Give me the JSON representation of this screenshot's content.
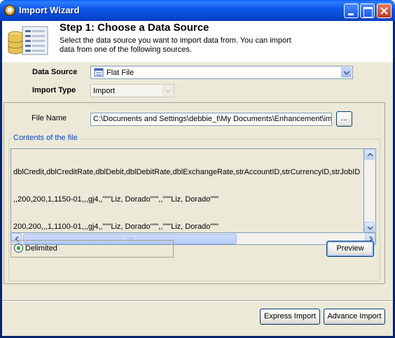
{
  "window": {
    "title": "Import Wizard"
  },
  "header": {
    "title": "Step 1: Choose a Data Source",
    "description_line1": "Select the data source you want to import data from. You can import",
    "description_line2": "data from one of the following sources."
  },
  "data_source": {
    "label": "Data Source",
    "value": "Flat File"
  },
  "import_type": {
    "label": "Import Type",
    "value": "Import"
  },
  "file": {
    "label": "File Name",
    "value": "C:\\Documents and Settings\\debbie_t\\My Documents\\Enhancement\\imp",
    "browse_label": "..."
  },
  "contents": {
    "legend": "Contents of the file",
    "lines": [
      "dblCredit,dblCreditRate,dblDebit,dblDebitRate,dblExchangeRate,strAccountID,strCurrencyID,strJobID",
      ",,200,200,1,1150-01,,,gj4,,\"\"\"Liz, Dorado\"\"\",,\"\"\"Liz, Dorado\"\"\"",
      "200,200,,,1,1100-01,,,gj4,,\"\"\"Liz, Dorado\"\"\",,\"\"\"Liz, Dorado\"\"\""
    ]
  },
  "format": {
    "delimited_label": "Delimited",
    "preview_label": "Preview"
  },
  "footer": {
    "express_label": "Express Import",
    "advance_label": "Advance Import"
  }
}
